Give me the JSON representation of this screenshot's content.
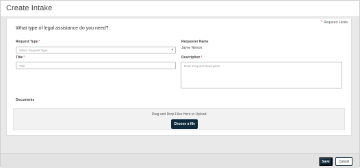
{
  "modal": {
    "title": "Create Intake"
  },
  "form": {
    "required_legend": "Required Fields",
    "required_marker": "*",
    "question": "What type of legal assistance do you need?",
    "request_type": {
      "label": "Request Type",
      "placeholder": "Select Request Type"
    },
    "title": {
      "label": "Title",
      "placeholder": "Title"
    },
    "requester": {
      "label": "Requester Name",
      "value": "Jayne Nelson"
    },
    "description": {
      "label": "Description",
      "placeholder": "Enter Request Description"
    }
  },
  "documents": {
    "label": "Documents",
    "dropzone_hint": "Drag and Drop Files Here to Upload",
    "choose_file_label": "Choose a file"
  },
  "footer": {
    "save_label": "Save",
    "cancel_label": "Cancel"
  },
  "colors": {
    "primary": "#0f2a3d",
    "required": "#d9363e"
  },
  "icons": {
    "request_type_caret": "caret-down-icon"
  }
}
